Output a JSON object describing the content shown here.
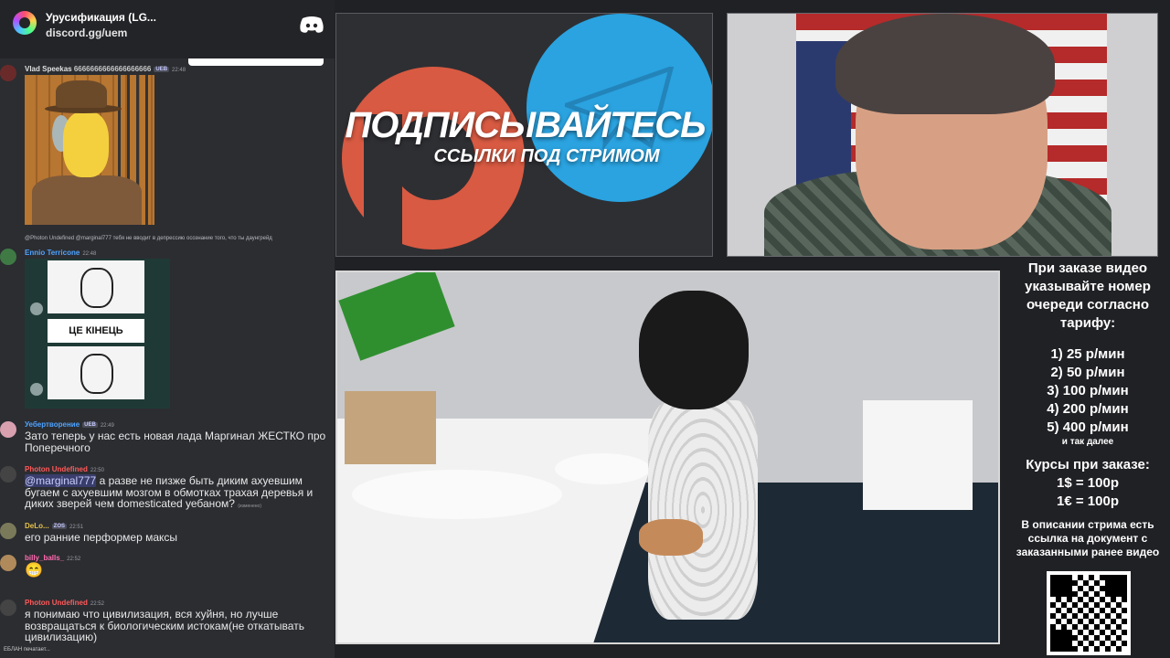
{
  "server": {
    "name": "Урусификация (LG...",
    "invite": "discord.gg/uem"
  },
  "messages": [
    {
      "user": "Vlad Speekas",
      "text_inline": "6666666666666666666",
      "tag": "UEB",
      "time": "22:48",
      "color": "#e0e0e0"
    },
    {
      "reply": "@Photon Undefined @marginal777 тебя не вводит в депрессию осознание того, что ты даунгрейд",
      "user": "Ennio Terricone",
      "time": "22:48",
      "color": "#4fa3ff"
    },
    {
      "user": "Уебертворение",
      "tag": "UEB",
      "time": "22:49",
      "color": "#4fa3ff",
      "text": "Зато теперь у нас есть новая лада Маргинал ЖЕСТКО про Поперечного"
    },
    {
      "user": "Photon Undefined",
      "time": "22:50",
      "color": "#ff5a5a",
      "mention": "@marginal777",
      "text": " а разве не пизже быть диким ахуевшим бугаем с ахуевшим мозгом в обмотках трахая деревья и диких зверей чем domesticated уебаном?",
      "edited": "(изменено)"
    },
    {
      "user": "DeLo...",
      "tag": "ZOS",
      "time": "22:51",
      "color": "#e6c14a",
      "text": "его ранние перформер максы"
    },
    {
      "user": "billy_balls_",
      "time": "22:52",
      "color": "#ff6bb0",
      "text": "😁"
    },
    {
      "user": "Photon Undefined",
      "time": "22:52",
      "color": "#ff5a5a",
      "text": "я понимаю что цивилизация, вся хуйня, но лучше возвращаться к биологическим истокам(не откатывать цивилизацию)"
    }
  ],
  "meme2_caption": "ЦЕ КІНЕЦЬ",
  "typing": "ЕБЛАН печатает...",
  "promo": {
    "line1": "ПОДПИСЫВАЙТЕСЬ",
    "line2": "ССЫЛКИ ПОД СТРИМОМ"
  },
  "info": {
    "head": "При заказе видео указывайте номер очереди согласно тарифу:",
    "tariffs": [
      "1) 25 р/мин",
      "2) 50 р/мин",
      "3) 100 р/мин",
      "4) 200 р/мин",
      "5) 400 р/мин"
    ],
    "etc": "и так далее",
    "rates_head": "Курсы при заказе:",
    "rates": [
      "1$ = 100р",
      "1€ = 100р"
    ],
    "desc": "В описании стрима есть ссылка на документ с заказанными ранее видео"
  }
}
